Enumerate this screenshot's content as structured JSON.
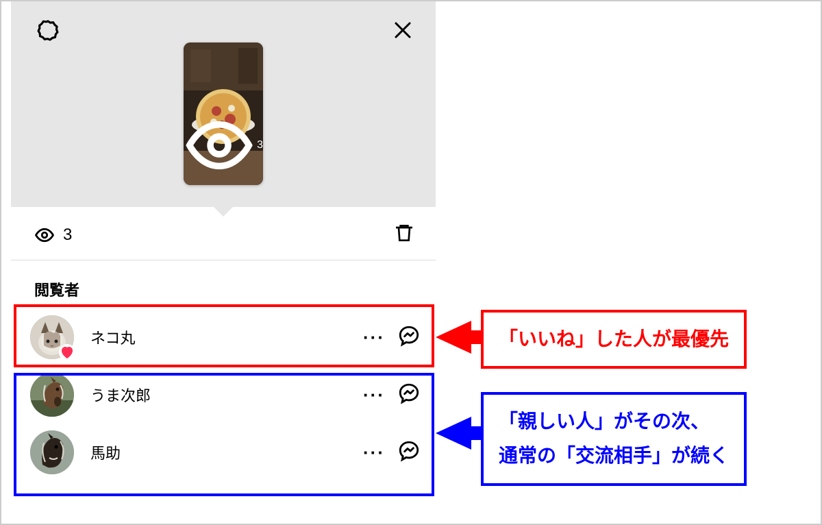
{
  "story": {
    "thumb_view_count": "3"
  },
  "count_row": {
    "count": "3"
  },
  "section_title": "閲覧者",
  "viewers": [
    {
      "name": "ネコ丸",
      "liked": true
    },
    {
      "name": "うま次郎",
      "liked": false
    },
    {
      "name": "馬助",
      "liked": false
    }
  ],
  "callouts": {
    "red": "「いいね」した人が最優先",
    "blue_line1": "「親しい人」がその次、",
    "blue_line2": "通常の「交流相手」が続く"
  },
  "icons": {
    "settings": "settings-icon",
    "close": "close-icon",
    "eye": "eye-icon",
    "trash": "trash-icon",
    "more": "more-icon",
    "messenger": "messenger-icon",
    "heart": "heart-icon"
  }
}
